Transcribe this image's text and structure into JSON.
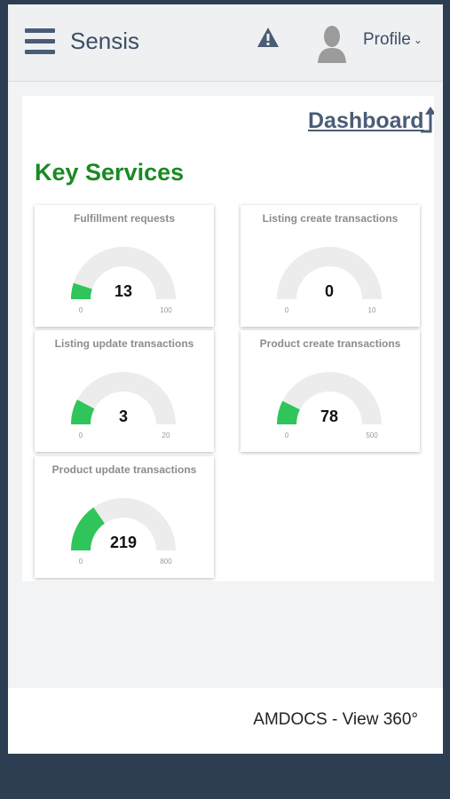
{
  "header": {
    "app_name": "Sensis",
    "profile_label": "Profile",
    "icons": [
      "menu-icon",
      "warning-icon",
      "user-avatar-icon",
      "chevron-down-icon"
    ]
  },
  "dashboard_link": "Dashboard",
  "section_title": "Key Services",
  "colors": {
    "gauge_fill": "#2fc55a",
    "gauge_track": "#ececec",
    "title_green": "#1a8a23",
    "header_text": "#3d4e64"
  },
  "gauges": [
    {
      "title": "Fulfillment requests",
      "value": "13",
      "min": "0",
      "max": "100"
    },
    {
      "title": "Listing create transactions",
      "value": "0",
      "min": "0",
      "max": "10"
    },
    {
      "title": "Listing update transactions",
      "value": "3",
      "min": "0",
      "max": "20"
    },
    {
      "title": "Product create transactions",
      "value": "78",
      "min": "0",
      "max": "500"
    },
    {
      "title": "Product update transactions",
      "value": "219",
      "min": "0",
      "max": "800"
    }
  ],
  "footer_text": "AMDOCS - View 360°"
}
